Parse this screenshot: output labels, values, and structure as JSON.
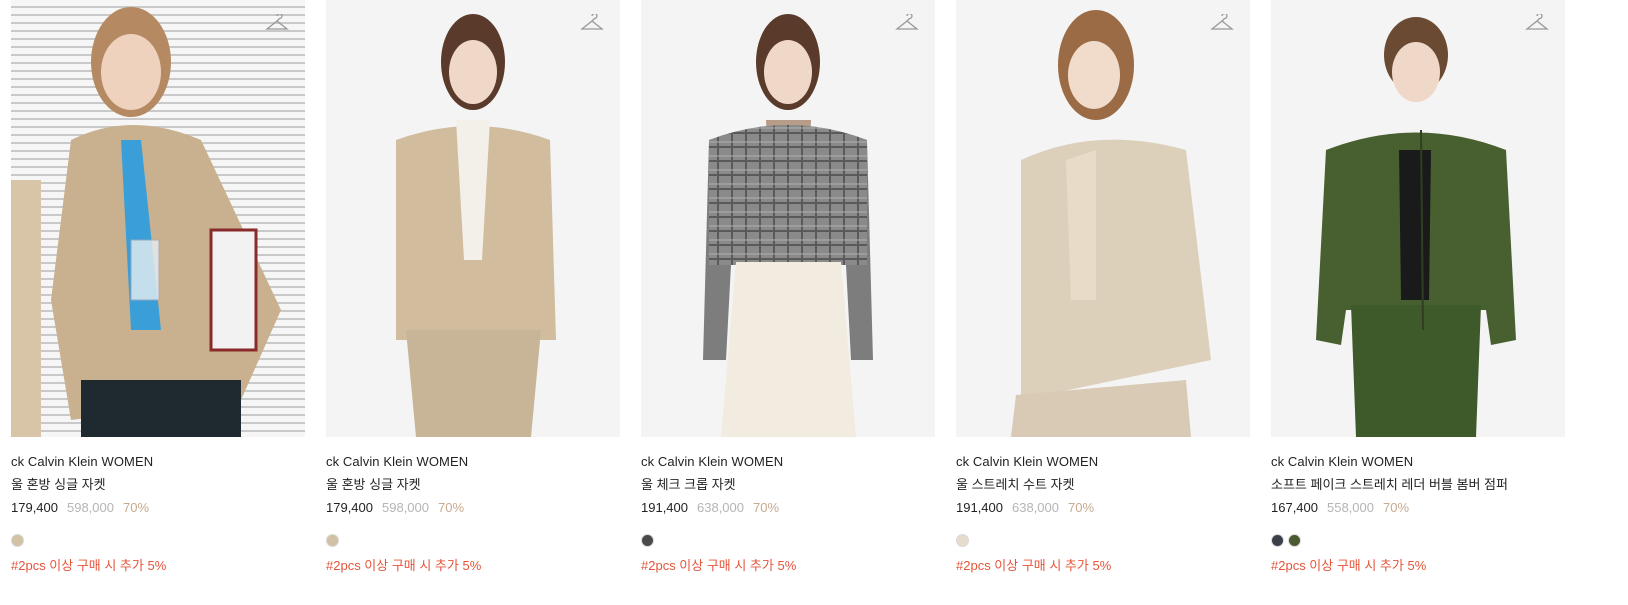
{
  "products": [
    {
      "brand": "ck Calvin Klein WOMEN",
      "name": "울 혼방 싱글 자켓",
      "price": "179,400",
      "original_price": "598,000",
      "discount": "70%",
      "swatches": [
        "#d2c1a5"
      ],
      "promo": "#2pcs 이상 구매 시 추가 5%",
      "jacket_color": "#c9b08e",
      "inner_color": "#3a9fd8",
      "bottom_color": "#1f2a30"
    },
    {
      "brand": "ck Calvin Klein WOMEN",
      "name": "울 혼방 싱글 자켓",
      "price": "179,400",
      "original_price": "598,000",
      "discount": "70%",
      "swatches": [
        "#d2c1a5"
      ],
      "promo": "#2pcs 이상 구매 시 추가 5%",
      "jacket_color": "#d1bd9e",
      "inner_color": "#f3f0ea",
      "bottom_color": "#c8b497"
    },
    {
      "brand": "ck Calvin Klein WOMEN",
      "name": "울 체크 크롭 자켓",
      "price": "191,400",
      "original_price": "638,000",
      "discount": "70%",
      "swatches": [
        "#4a4a4a"
      ],
      "promo": "#2pcs 이상 구매 시 추가 5%",
      "jacket_color": "#7d7d7d",
      "inner_color": "#b79c87",
      "bottom_color": "#f1ecdf"
    },
    {
      "brand": "ck Calvin Klein WOMEN",
      "name": "울 스트레치 수트 자켓",
      "price": "191,400",
      "original_price": "638,000",
      "discount": "70%",
      "swatches": [
        "#e6dccd"
      ],
      "promo": "#2pcs 이상 구매 시 추가 5%",
      "jacket_color": "#ddd0bb",
      "inner_color": "#e8dcc8",
      "bottom_color": "#d8cab4"
    },
    {
      "brand": "ck Calvin Klein WOMEN",
      "name": "소프트 페이크 스트레치 레더 버블 봄버 점퍼",
      "price": "167,400",
      "original_price": "558,000",
      "discount": "70%",
      "swatches": [
        "#3a3f4a",
        "#4a5a32"
      ],
      "promo": "#2pcs 이상 구매 시 추가 5%",
      "jacket_color": "#48602f",
      "inner_color": "#1a1a1a",
      "bottom_color": "#3f5a2a"
    }
  ]
}
